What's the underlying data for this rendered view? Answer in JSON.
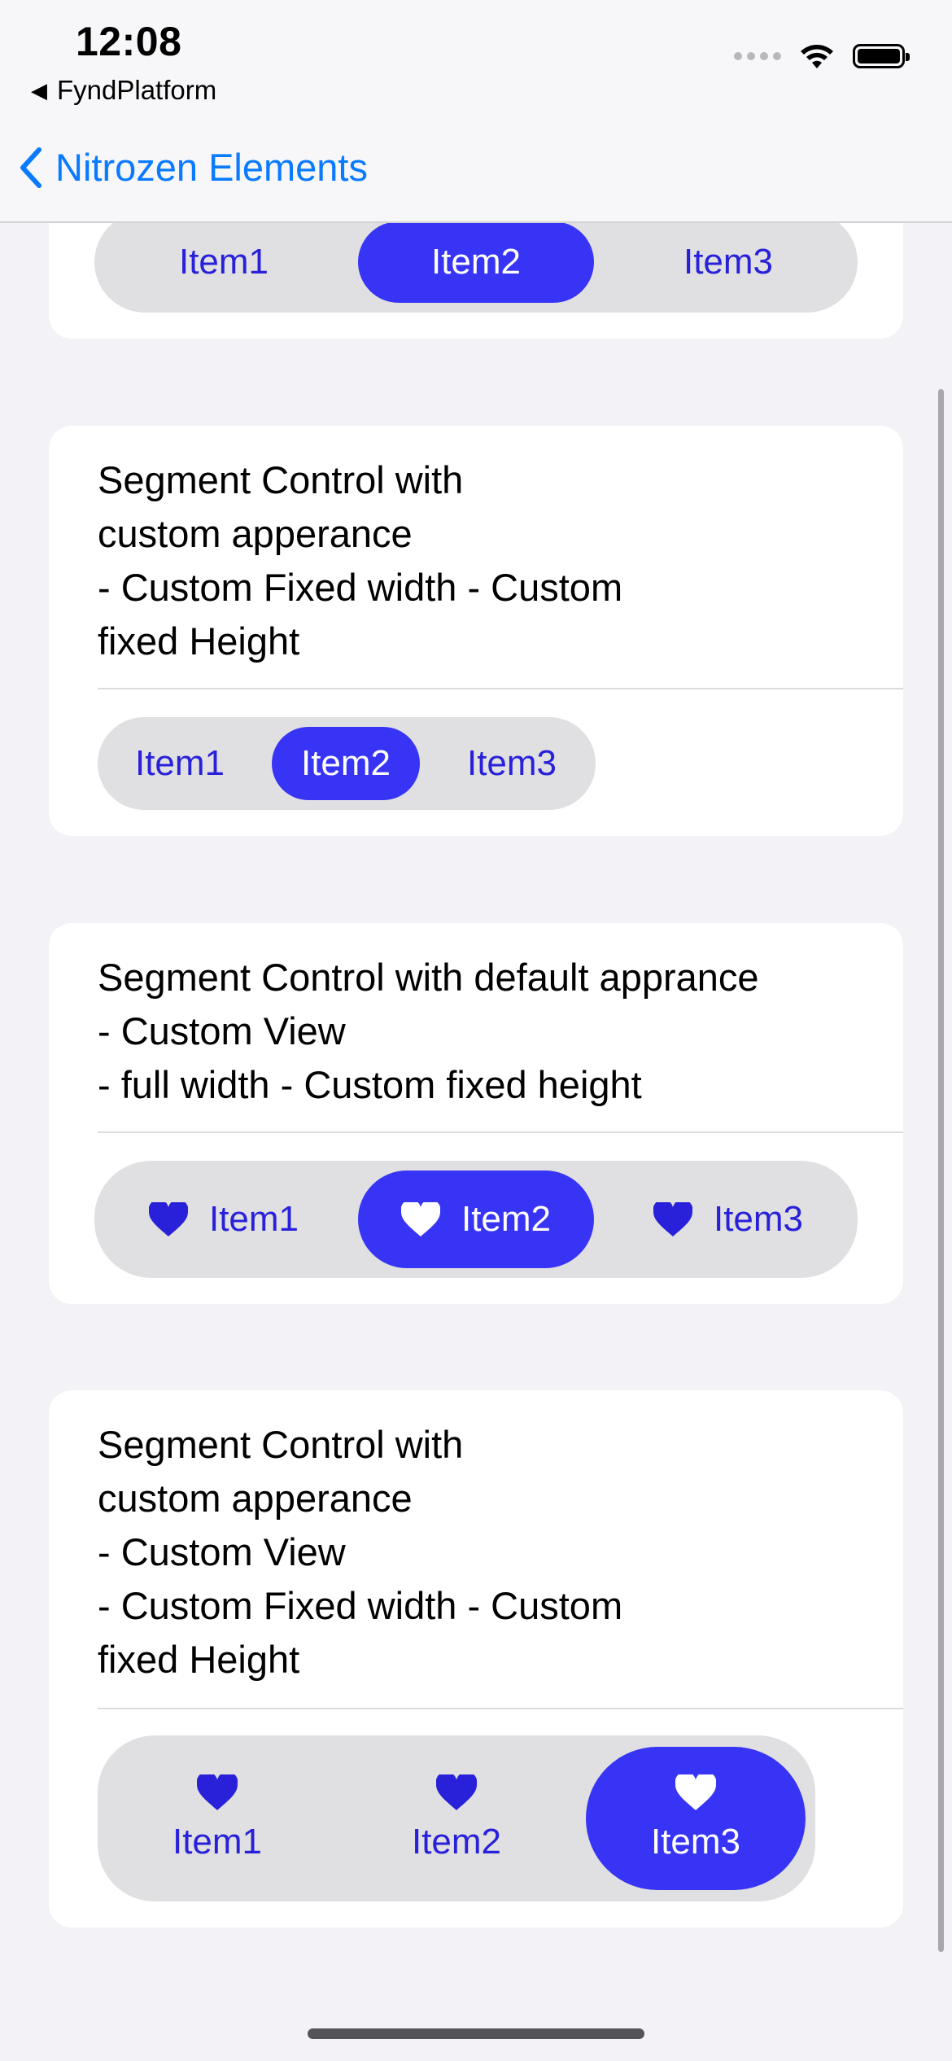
{
  "status_bar": {
    "time": "12:08",
    "back_app": "FyndPlatform"
  },
  "nav": {
    "back_title": "Nitrozen Elements"
  },
  "colors": {
    "accent": "#3834f5",
    "segment_bg": "#e0e0e2",
    "nav_link": "#0a7aff",
    "unselected_text": "#2821d9"
  },
  "cards": [
    {
      "title": "",
      "segments": [
        {
          "label": "Item1",
          "selected": false
        },
        {
          "label": "Item2",
          "selected": true
        },
        {
          "label": "Item3",
          "selected": false
        }
      ]
    },
    {
      "title": "Segment Control with\ncustom apperance\n- Custom Fixed width - Custom\nfixed Height",
      "segments": [
        {
          "label": "Item1",
          "selected": false
        },
        {
          "label": "Item2",
          "selected": true
        },
        {
          "label": "Item3",
          "selected": false
        }
      ]
    },
    {
      "title": "Segment Control with default apprance\n- Custom View\n- full width - Custom fixed height",
      "segments": [
        {
          "label": "Item1",
          "selected": false,
          "icon": "heart-icon"
        },
        {
          "label": "Item2",
          "selected": true,
          "icon": "heart-icon"
        },
        {
          "label": "Item3",
          "selected": false,
          "icon": "heart-icon"
        }
      ]
    },
    {
      "title": "Segment Control with\ncustom apperance\n- Custom View\n- Custom Fixed width - Custom\nfixed Height",
      "segments": [
        {
          "label": "Item1",
          "selected": false,
          "icon": "heart-icon"
        },
        {
          "label": "Item2",
          "selected": false,
          "icon": "heart-icon"
        },
        {
          "label": "Item3",
          "selected": true,
          "icon": "heart-icon"
        }
      ]
    }
  ]
}
